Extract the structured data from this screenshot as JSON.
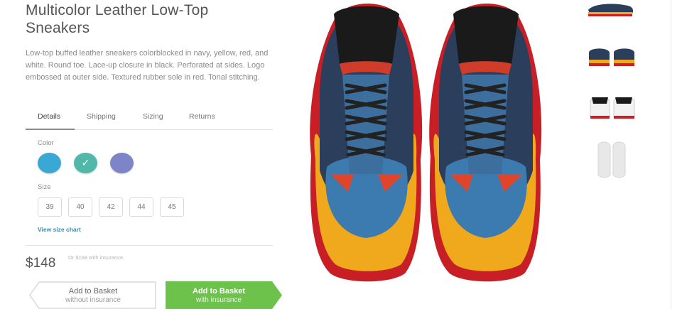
{
  "product": {
    "title": "Multicolor Leather Low-Top Sneakers",
    "description": "Low-top buffed leather sneakers colorblocked in navy, yellow, red, and white. Round toe. Lace-up closure in black. Perforated at sides. Logo embossed at outer side. Textured rubber sole in red. Tonal stitching."
  },
  "tabs": [
    {
      "label": "Details",
      "active": true
    },
    {
      "label": "Shipping",
      "active": false
    },
    {
      "label": "Sizing",
      "active": false
    },
    {
      "label": "Returns",
      "active": false
    }
  ],
  "color": {
    "label": "Color",
    "swatches": [
      {
        "hex": "#3aa8d4",
        "selected": false
      },
      {
        "hex": "#4fb8a8",
        "selected": true
      },
      {
        "hex": "#7d84c8",
        "selected": false
      }
    ]
  },
  "size": {
    "label": "Size",
    "options": [
      "39",
      "40",
      "42",
      "44",
      "45"
    ],
    "chart_link": "View size chart"
  },
  "pricing": {
    "price": "$148",
    "note": "Or $168 with insurance."
  },
  "buttons": {
    "without_insurance": {
      "main": "Add to Basket",
      "sub": "without insurance"
    },
    "with_insurance": {
      "main": "Add to Basket",
      "sub": "with insurance"
    }
  },
  "colors": {
    "accent_green": "#6cc24a",
    "link_blue": "#3a8fb7"
  },
  "icons": [
    "check-icon"
  ]
}
